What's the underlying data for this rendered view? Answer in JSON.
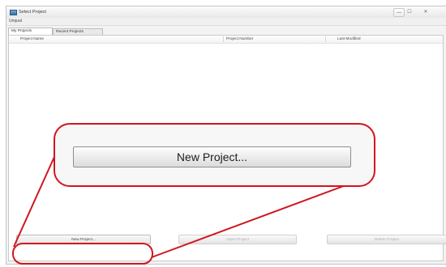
{
  "window": {
    "title": "Select Project",
    "controls": {
      "minimize": "—",
      "maximize": "☐",
      "close": "✕"
    }
  },
  "menu": {
    "items": [
      "Unqual"
    ]
  },
  "tabs": [
    {
      "label": "My Projects",
      "active": true
    },
    {
      "label": "Recent Projects",
      "active": false
    }
  ],
  "table": {
    "columns": [
      "Project Name",
      "Project Number",
      "Last Modified"
    ],
    "rows": []
  },
  "buttons": {
    "new_project": "New Project...",
    "open_project": "Open Project",
    "delete_project": "Delete Project"
  },
  "callout": {
    "label": "New Project...",
    "color": "#d0161f"
  }
}
